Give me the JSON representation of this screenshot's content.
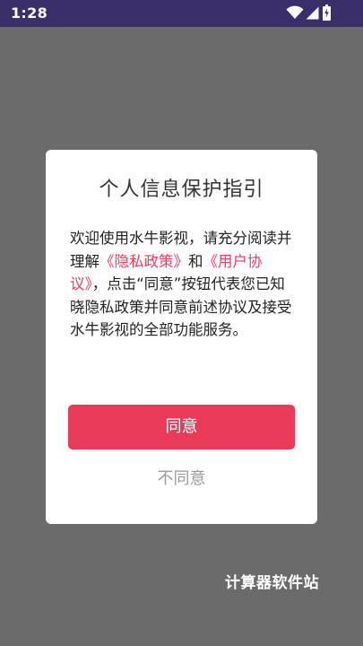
{
  "status_bar": {
    "time": "1:28",
    "icons": [
      "wifi-icon",
      "cellular-signal-icon",
      "battery-charging-icon"
    ],
    "background": "#3a2f68"
  },
  "dialog": {
    "title": "个人信息保护指引",
    "body": {
      "text_1": "欢迎使用水牛影视，请充分阅读并理解",
      "privacy_link": "《隐私政策》",
      "text_2": "和",
      "user_agreement_link": "《用户协议》",
      "text_3": "，点击“同意”按钮代表您已知晓隐私政策并同意前述协议及接受水牛影视的全部功能服务。"
    },
    "agree_label": "同意",
    "disagree_label": "不同意"
  },
  "watermark": "计算器软件站",
  "colors": {
    "accent": "#e93a59",
    "link": "#ea3f5e",
    "overlay": "#6b6b6b"
  }
}
